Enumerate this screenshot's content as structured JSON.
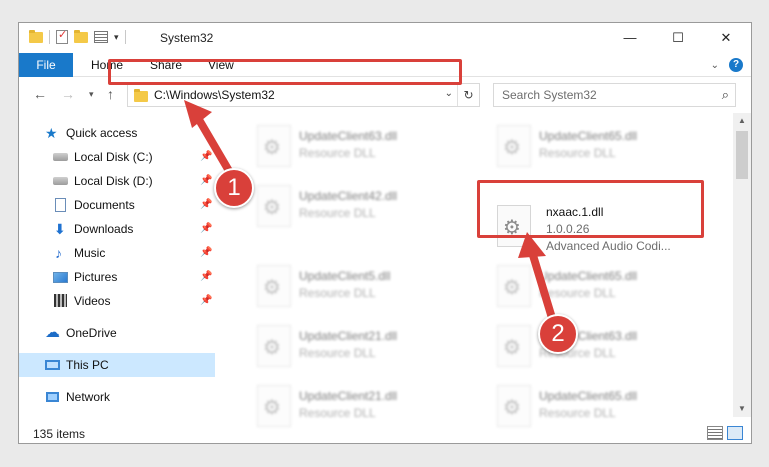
{
  "window": {
    "title": "System32",
    "minimize": "—",
    "maximize": "☐",
    "close": "✕"
  },
  "ribbon": {
    "tabs": [
      "File",
      "Home",
      "Share",
      "View"
    ],
    "help": "?"
  },
  "address": {
    "path": "C:\\Windows\\System32",
    "search_placeholder": "Search System32"
  },
  "sidebar": {
    "items": [
      {
        "label": "Quick access",
        "icon": "star-icon"
      },
      {
        "label": "Local Disk (C:)",
        "icon": "drive-icon",
        "pinned": true
      },
      {
        "label": "Local Disk (D:)",
        "icon": "drive-icon",
        "pinned": true
      },
      {
        "label": "Documents",
        "icon": "documents-icon",
        "pinned": true
      },
      {
        "label": "Downloads",
        "icon": "downloads-icon",
        "pinned": true
      },
      {
        "label": "Music",
        "icon": "music-icon",
        "pinned": true
      },
      {
        "label": "Pictures",
        "icon": "pictures-icon",
        "pinned": true
      },
      {
        "label": "Videos",
        "icon": "videos-icon",
        "pinned": true
      },
      {
        "label": "OneDrive",
        "icon": "onedrive-icon"
      },
      {
        "label": "This PC",
        "icon": "pc-icon",
        "selected": true
      },
      {
        "label": "Network",
        "icon": "network-icon"
      }
    ]
  },
  "files": {
    "items": [
      {
        "name": "UpdateClient63.dll",
        "desc": "Resource DLL"
      },
      {
        "name": "UpdateClient65.dll",
        "desc": "Resource DLL"
      },
      {
        "name": "UpdateClient42.dll",
        "desc": "Resource DLL"
      },
      {
        "name": "nxaac.1.dll",
        "desc": "1.0.0.26",
        "sub": "Advanced Audio Codi..."
      },
      {
        "name": "UpdateClient5.dll",
        "desc": "Resource DLL"
      },
      {
        "name": "UpdateClient65.dll",
        "desc": "Resource DLL"
      },
      {
        "name": "UpdateClient21.dll",
        "desc": "Resource DLL"
      },
      {
        "name": "UpdateClient63.dll",
        "desc": "Resource DLL"
      },
      {
        "name": "UpdateClient21.dll",
        "desc": "Resource DLL"
      },
      {
        "name": "UpdateClient65.dll",
        "desc": "Resource DLL"
      }
    ]
  },
  "status": {
    "count": "135 items"
  },
  "callouts": {
    "one": "1",
    "two": "2"
  },
  "colors": {
    "accent": "#1979ca",
    "highlight": "#d9403a",
    "selected_bg": "#cce8ff"
  }
}
